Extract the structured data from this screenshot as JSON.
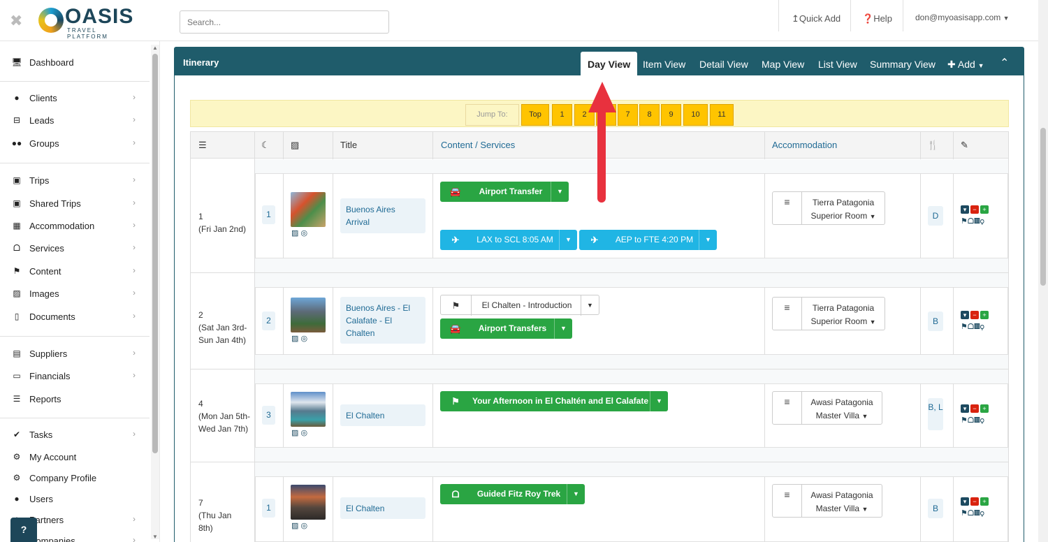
{
  "topbar": {
    "brand": "OASIS",
    "brand_sub": "TRAVEL PLATFORM",
    "search_placeholder": "Search...",
    "quick_add": "Quick Add",
    "help": "Help",
    "user": "don@myoasisapp.com"
  },
  "sidebar": {
    "items": [
      {
        "label": "Dashboard",
        "icon": "monitor-icon"
      },
      {
        "label": "Clients",
        "icon": "user-icon"
      },
      {
        "label": "Leads",
        "icon": "inbox-icon"
      },
      {
        "label": "Groups",
        "icon": "users-icon"
      },
      {
        "label": "Trips",
        "icon": "suitcase-icon"
      },
      {
        "label": "Shared Trips",
        "icon": "suitcase-icon"
      },
      {
        "label": "Accommodation",
        "icon": "building-icon"
      },
      {
        "label": "Services",
        "icon": "binoculars-icon"
      },
      {
        "label": "Content",
        "icon": "flag-icon"
      },
      {
        "label": "Images",
        "icon": "image-icon"
      },
      {
        "label": "Documents",
        "icon": "document-icon"
      },
      {
        "label": "Suppliers",
        "icon": "archive-icon"
      },
      {
        "label": "Financials",
        "icon": "money-icon"
      },
      {
        "label": "Reports",
        "icon": "list-icon"
      },
      {
        "label": "Tasks",
        "icon": "check-icon"
      },
      {
        "label": "My Account",
        "icon": "gear-icon"
      },
      {
        "label": "Company Profile",
        "icon": "gears-icon"
      },
      {
        "label": "Users",
        "icon": "user-icon"
      },
      {
        "label": "Partners",
        "icon": "handshake-icon"
      },
      {
        "label": "Companies",
        "icon": "building-icon"
      }
    ],
    "help_button": "?"
  },
  "panel": {
    "title": "Itinerary",
    "tabs": [
      "Day View",
      "Item View",
      "Detail View",
      "Map View",
      "List View",
      "Summary View"
    ],
    "active_tab": "Day View",
    "add_label": "Add"
  },
  "jump": {
    "label": "Jump To:",
    "buttons": [
      "Top",
      "1",
      "2",
      "",
      "7",
      "8",
      "9",
      "10",
      "11"
    ]
  },
  "table": {
    "headers": {
      "title": "Title",
      "content": "Content / Services",
      "accommodation": "Accommodation"
    }
  },
  "rows": [
    {
      "day_num": "1",
      "day_range": "(Fri Jan 2nd)",
      "nights": "1",
      "title": "Buenos Aires Arrival",
      "services": [
        "Airport Transfer",
        "LAX to SCL 8:05 AM",
        "AEP to FTE 4:20 PM"
      ],
      "acc_line1": "Tierra Patagonia",
      "acc_line2": "Superior Room",
      "meals": "D"
    },
    {
      "day_num": "2",
      "day_range": "(Sat Jan 3rd-Sun Jan 4th)",
      "nights": "2",
      "title": "Buenos Aires - El Calafate - El Chalten",
      "services": [
        "El Chalten - Introduction",
        "Airport Transfers"
      ],
      "acc_line1": "Tierra Patagonia",
      "acc_line2": "Superior Room",
      "meals": "B"
    },
    {
      "day_num": "4",
      "day_range": "(Mon Jan 5th-Wed Jan 7th)",
      "nights": "3",
      "title": "El Chalten",
      "services": [
        "Your Afternoon in El Chaltén and El Calafate"
      ],
      "acc_line1": "Awasi Patagonia",
      "acc_line2": "Master Villa",
      "meals": "B, L"
    },
    {
      "day_num": "7",
      "day_range": "(Thu Jan 8th)",
      "nights": "1",
      "title": "El Chalten",
      "services": [
        "Guided Fitz Roy Trek"
      ],
      "acc_line1": "Awasi Patagonia",
      "acc_line2": "Master Villa",
      "meals": "B"
    }
  ],
  "colors": {
    "brand": "#1f5c6b",
    "green": "#2aa543",
    "blue": "#20b5e4",
    "jump": "#ffc400",
    "arrow": "#e8313e"
  }
}
